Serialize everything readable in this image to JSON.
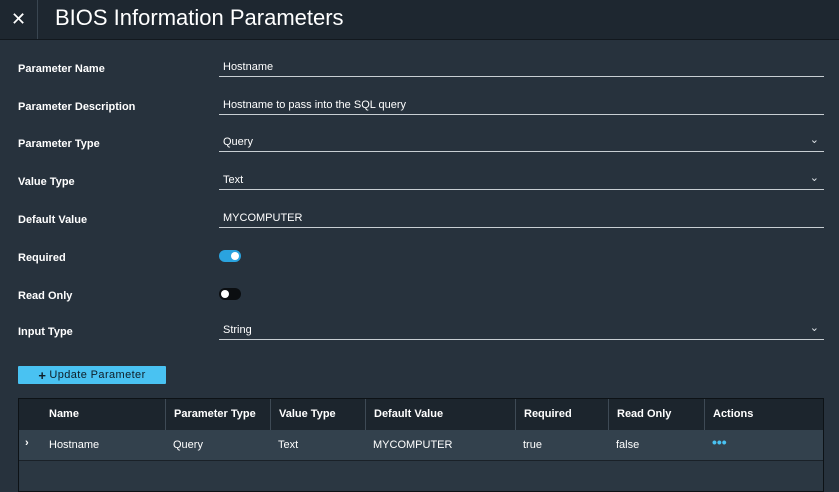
{
  "window": {
    "title": "BIOS Information Parameters",
    "close_glyph": "✕"
  },
  "form": {
    "parameter_name": {
      "label": "Parameter Name",
      "value": "Hostname"
    },
    "parameter_description": {
      "label": "Parameter Description",
      "value": "Hostname to pass into the SQL query"
    },
    "parameter_type": {
      "label": "Parameter Type",
      "value": "Query"
    },
    "value_type": {
      "label": "Value Type",
      "value": "Text"
    },
    "default_value": {
      "label": "Default Value",
      "value": "MYCOMPUTER"
    },
    "required": {
      "label": "Required",
      "checked": true
    },
    "read_only": {
      "label": "Read Only",
      "checked": false
    },
    "input_type": {
      "label": "Input Type",
      "value": "String"
    }
  },
  "update_button": {
    "icon": "plus-icon",
    "label": "Update Parameter"
  },
  "table": {
    "columns": [
      "Name",
      "Parameter Type",
      "Value Type",
      "Default Value",
      "Required",
      "Read Only",
      "Actions"
    ],
    "rows": [
      {
        "name": "Hostname",
        "parameter_type": "Query",
        "value_type": "Text",
        "default_value": "MYCOMPUTER",
        "required": "true",
        "read_only": "false",
        "actions": "•••"
      }
    ]
  },
  "colors": {
    "background": "#27323d",
    "titlebar": "#1e2730",
    "accent": "#49c2f2",
    "toggle_on": "#2aa3df"
  }
}
